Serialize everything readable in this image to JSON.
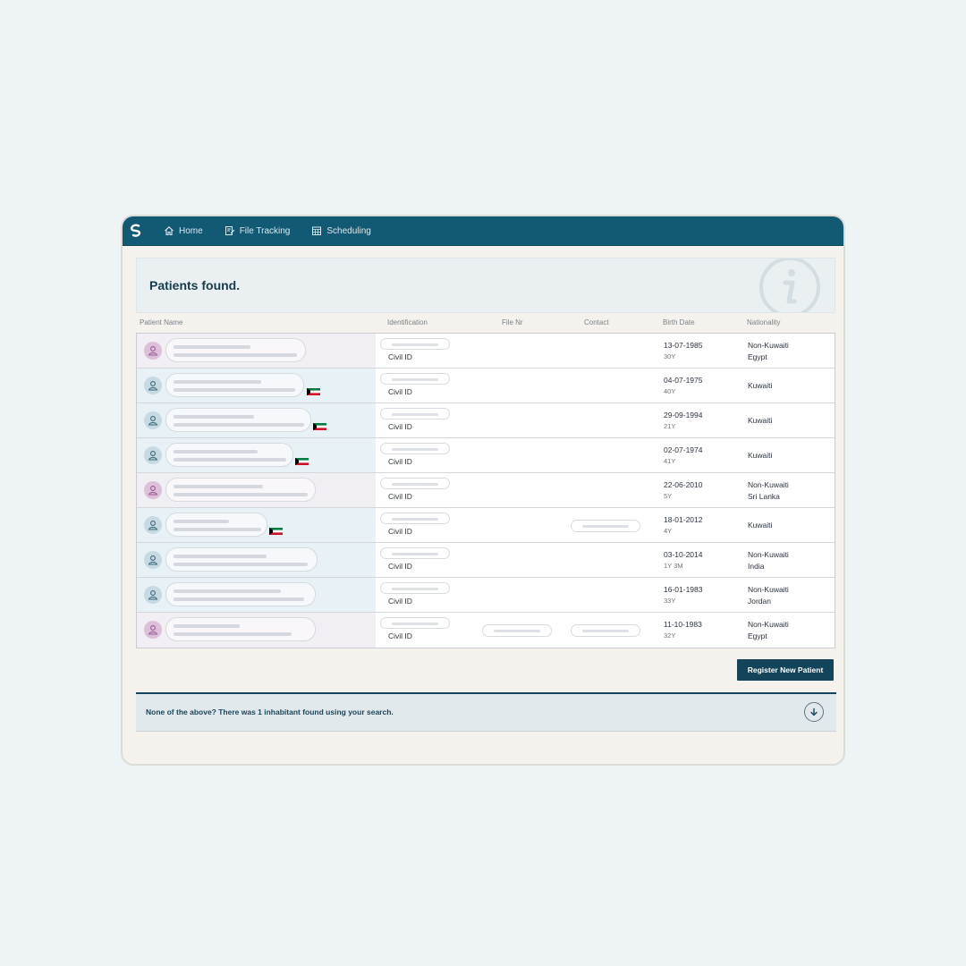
{
  "nav": {
    "home_label": "Home",
    "file_tracking_label": "File Tracking",
    "scheduling_label": "Scheduling"
  },
  "banner": {
    "title": "Patients found."
  },
  "table": {
    "columns": [
      "Patient Name",
      "Identification",
      "File Nr",
      "Contact",
      "Birth Date",
      "Nationality"
    ],
    "rows": [
      {
        "gender": "female",
        "id_type": "Civil ID",
        "birth_date": "13-07-1985",
        "age": "30Y",
        "nationality": "Non-Kuwaiti",
        "country": "Egypt",
        "flag": false
      },
      {
        "gender": "male",
        "id_type": "Civil ID",
        "birth_date": "04-07-1975",
        "age": "40Y",
        "nationality": "Kuwaiti",
        "country": "",
        "flag": true
      },
      {
        "gender": "male",
        "id_type": "Civil ID",
        "birth_date": "29-09-1994",
        "age": "21Y",
        "nationality": "Kuwaiti",
        "country": "",
        "flag": true
      },
      {
        "gender": "male",
        "id_type": "Civil ID",
        "birth_date": "02-07-1974",
        "age": "41Y",
        "nationality": "Kuwaiti",
        "country": "",
        "flag": true
      },
      {
        "gender": "female",
        "id_type": "Civil ID",
        "birth_date": "22-06-2010",
        "age": "5Y",
        "nationality": "Non-Kuwaiti",
        "country": "Sri Lanka",
        "flag": false
      },
      {
        "gender": "male",
        "id_type": "Civil ID",
        "birth_date": "18-01-2012",
        "age": "4Y",
        "nationality": "Kuwaiti",
        "country": "",
        "flag": true
      },
      {
        "gender": "male",
        "id_type": "Civil ID",
        "birth_date": "03-10-2014",
        "age": "1Y 3M",
        "nationality": "Non-Kuwaiti",
        "country": "India",
        "flag": false
      },
      {
        "gender": "male",
        "id_type": "Civil ID",
        "birth_date": "16-01-1983",
        "age": "33Y",
        "nationality": "Non-Kuwaiti",
        "country": "Jordan",
        "flag": false
      },
      {
        "gender": "female",
        "id_type": "Civil ID",
        "birth_date": "11-10-1983",
        "age": "32Y",
        "nationality": "Non-Kuwaiti",
        "country": "Egypt",
        "flag": false
      }
    ]
  },
  "actions": {
    "register_label": "Register New Patient"
  },
  "footer": {
    "text": "None of the above? There was 1 inhabitant found using your search."
  },
  "colors": {
    "primary": "#125974",
    "button": "#13445a",
    "female_bg": "#f1eef4",
    "male_bg": "#e8f1f6"
  },
  "icons": [
    "logo-icon",
    "home-icon",
    "file-tracking-icon",
    "scheduling-icon",
    "info-icon",
    "user-icon",
    "kuwait-flag-icon",
    "chevron-down-icon"
  ]
}
